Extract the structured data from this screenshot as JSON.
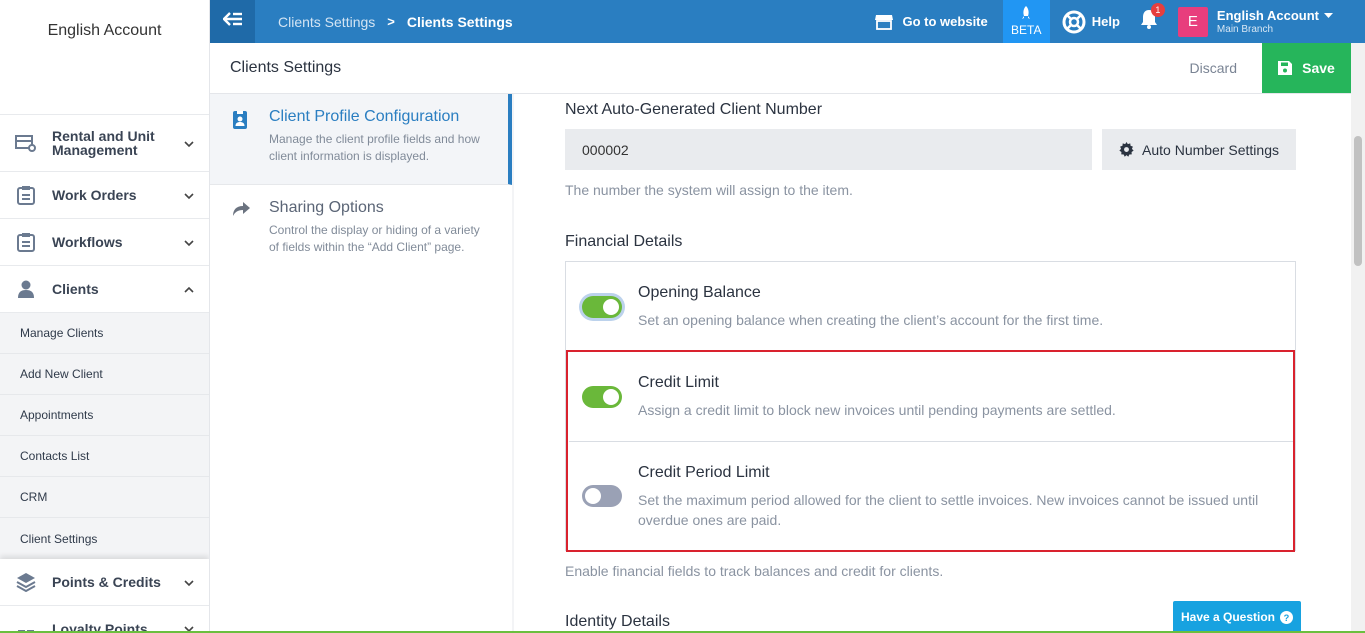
{
  "sidebar": {
    "account_name": "English Account",
    "items": [
      {
        "label": "Rental and Unit Management",
        "icon": "rental-unit-icon"
      },
      {
        "label": "Work Orders",
        "icon": "clipboard-icon"
      },
      {
        "label": "Workflows",
        "icon": "clipboard-icon"
      },
      {
        "label": "Clients",
        "icon": "user-icon"
      }
    ],
    "clients_sub": [
      "Manage Clients",
      "Add New Client",
      "Appointments",
      "Contacts List",
      "CRM",
      "Client Settings"
    ],
    "after_items": [
      {
        "label": "Points & Credits",
        "icon": "layers-icon"
      },
      {
        "label": "Loyalty Points",
        "icon": "gift-icon"
      }
    ]
  },
  "topbar": {
    "breadcrumb_1": "Clients Settings",
    "breadcrumb_sep": ">",
    "breadcrumb_2": "Clients Settings",
    "go_to_website": "Go to website",
    "beta": "BETA",
    "help": "Help",
    "notification_count": "1",
    "avatar_letter": "E",
    "account_name": "English Account",
    "branch": "Main Branch"
  },
  "page": {
    "title": "Clients Settings",
    "discard": "Discard",
    "save": "Save"
  },
  "settings_nav": [
    {
      "title": "Client Profile Configuration",
      "desc": "Manage the client profile fields and how client information is displayed."
    },
    {
      "title": "Sharing Options",
      "desc": "Control the display or hiding of a variety of fields within the “Add Client” page."
    }
  ],
  "content": {
    "next_number_label": "Next Auto-Generated Client Number",
    "next_number_value": "000002",
    "auto_number_button": "Auto Number Settings",
    "next_number_help": "The number the system will assign to the item.",
    "financial_label": "Financial Details",
    "rows": [
      {
        "title": "Opening Balance",
        "desc": "Set an opening balance when creating the client’s account for the first time.",
        "on": true
      },
      {
        "title": "Credit Limit",
        "desc": "Assign a credit limit to block new invoices until pending payments are settled.",
        "on": true
      },
      {
        "title": "Credit Period Limit",
        "desc": "Set the maximum period allowed for the client to settle invoices. New invoices cannot be issued until overdue ones are paid.",
        "on": false
      }
    ],
    "financial_help": "Enable financial fields to track balances and credit for clients.",
    "identity_label": "Identity Details"
  },
  "question_button": "Have a Question",
  "colors": {
    "topbar": "#2a7ec1",
    "save": "#26b55b",
    "toggle_on": "#6ab83a",
    "highlight": "#d9222e"
  }
}
